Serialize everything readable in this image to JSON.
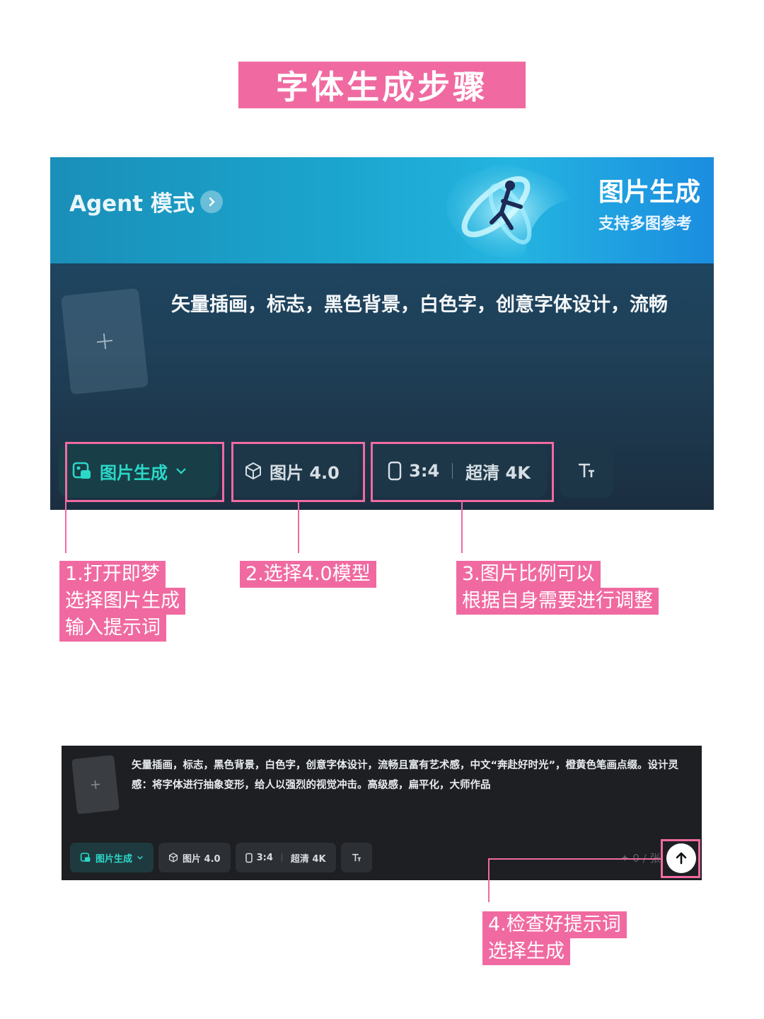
{
  "page_title": "字体生成步骤",
  "panel_top": {
    "agent_label": "Agent 模式",
    "banner_title": "图片生成",
    "banner_subtitle": "支持多图参考",
    "prompt_preview": "矢量插画，标志，黑色背景，白色字，创意字体设计，流畅",
    "toolbar": {
      "mode": "图片生成",
      "model": "图片 4.0",
      "ratio": "3:4",
      "quality": "超清 4K"
    }
  },
  "annotations": {
    "step1": [
      "1.打开即梦",
      "选择图片生成",
      "输入提示词"
    ],
    "step2": [
      "2.选择4.0模型"
    ],
    "step3": [
      "3.图片比例可以",
      "根据自身需要进行调整"
    ],
    "step4": [
      "4.检查好提示词",
      "选择生成"
    ]
  },
  "panel_bottom": {
    "prompt": "矢量插画，标志，黑色背景，白色字，创意字体设计，流畅且富有艺术感，中文“奔赴好时光”，橙黄色笔画点缀。设计灵感：将字体进行抽象变形，给人以强烈的视觉冲击。高级感，扁平化，大师作品",
    "toolbar": {
      "mode": "图片生成",
      "model": "图片 4.0",
      "ratio": "3:4",
      "quality": "超清 4K"
    },
    "counter": "✦ 0 / 张"
  },
  "colors": {
    "accent_pink": "#f06aa1",
    "teal": "#2bd8c8"
  },
  "icons": [
    "chevron-right-icon",
    "plus-icon",
    "image-gen-icon",
    "chevron-down-icon",
    "cube-icon",
    "ratio-icon",
    "text-size-icon",
    "arrow-up-icon"
  ]
}
